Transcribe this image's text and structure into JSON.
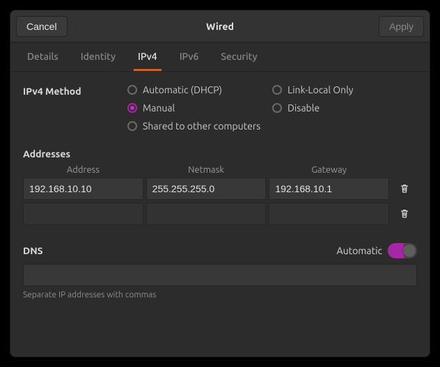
{
  "titlebar": {
    "cancel": "Cancel",
    "title": "Wired",
    "apply": "Apply"
  },
  "tabs": {
    "details": "Details",
    "identity": "Identity",
    "ipv4": "IPv4",
    "ipv6": "IPv6",
    "security": "Security",
    "active": "ipv4"
  },
  "ipv4": {
    "method_label": "IPv4 Method",
    "options": {
      "automatic": "Automatic (DHCP)",
      "manual": "Manual",
      "shared": "Shared to other computers",
      "link_local": "Link-Local Only",
      "disable": "Disable"
    },
    "selected": "manual"
  },
  "addresses": {
    "heading": "Addresses",
    "columns": {
      "address": "Address",
      "netmask": "Netmask",
      "gateway": "Gateway"
    },
    "rows": [
      {
        "address": "192.168.10.10",
        "netmask": "255.255.255.0",
        "gateway": "192.168.10.1"
      },
      {
        "address": "",
        "netmask": "",
        "gateway": ""
      }
    ]
  },
  "dns": {
    "heading": "DNS",
    "automatic_label": "Automatic",
    "automatic_on": true,
    "value": "",
    "hint": "Separate IP addresses with commas"
  }
}
